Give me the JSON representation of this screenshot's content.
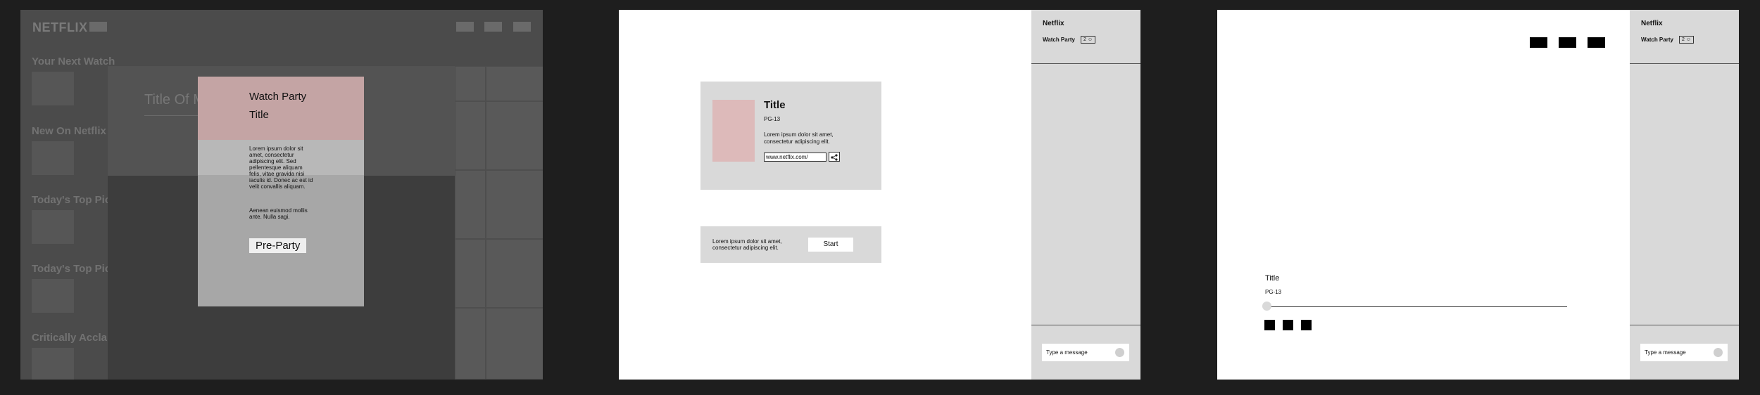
{
  "frame1": {
    "logo": "NETFLIX",
    "rows": [
      "Your Next Watch",
      "New On Netflix",
      "Today's Top Picks",
      "Today's Top Picks",
      "Critically Acclaim"
    ],
    "movie_title": "Title Of Mo",
    "modal": {
      "title": "Watch Party",
      "subtitle": "Title",
      "body1": "Lorem ipsum dolor sit amet, consectetur adipiscing elit. Sed pellentesque aliquam felis, vitae gravida nisi iaculis id. Donec ac est id velit convallis aliquam.",
      "body2": "Aenean euismod mollis ante. Nulla sagi.",
      "button": "Pre-Party"
    }
  },
  "panel": {
    "brand": "Netflix",
    "watch_party": "Watch Party",
    "badge": "2 ☺",
    "message_placeholder": "Type a message"
  },
  "frame2": {
    "title": "Title",
    "rating": "PG-13",
    "description": "Lorem ipsum dolor sit amet, consectetur adipiscing elit.",
    "url": "www.netflix.com/",
    "start_text": "Lorem ipsum dolor sit amet, consectetur adipiscing elit.",
    "start_button": "Start"
  },
  "frame3": {
    "title": "Title",
    "rating": "PG-13"
  },
  "colors": {
    "poster": "#ddbaba",
    "modal_header": "#c4a4a4",
    "panel": "#d9d9d9",
    "canvas": "#1e1e1e"
  }
}
